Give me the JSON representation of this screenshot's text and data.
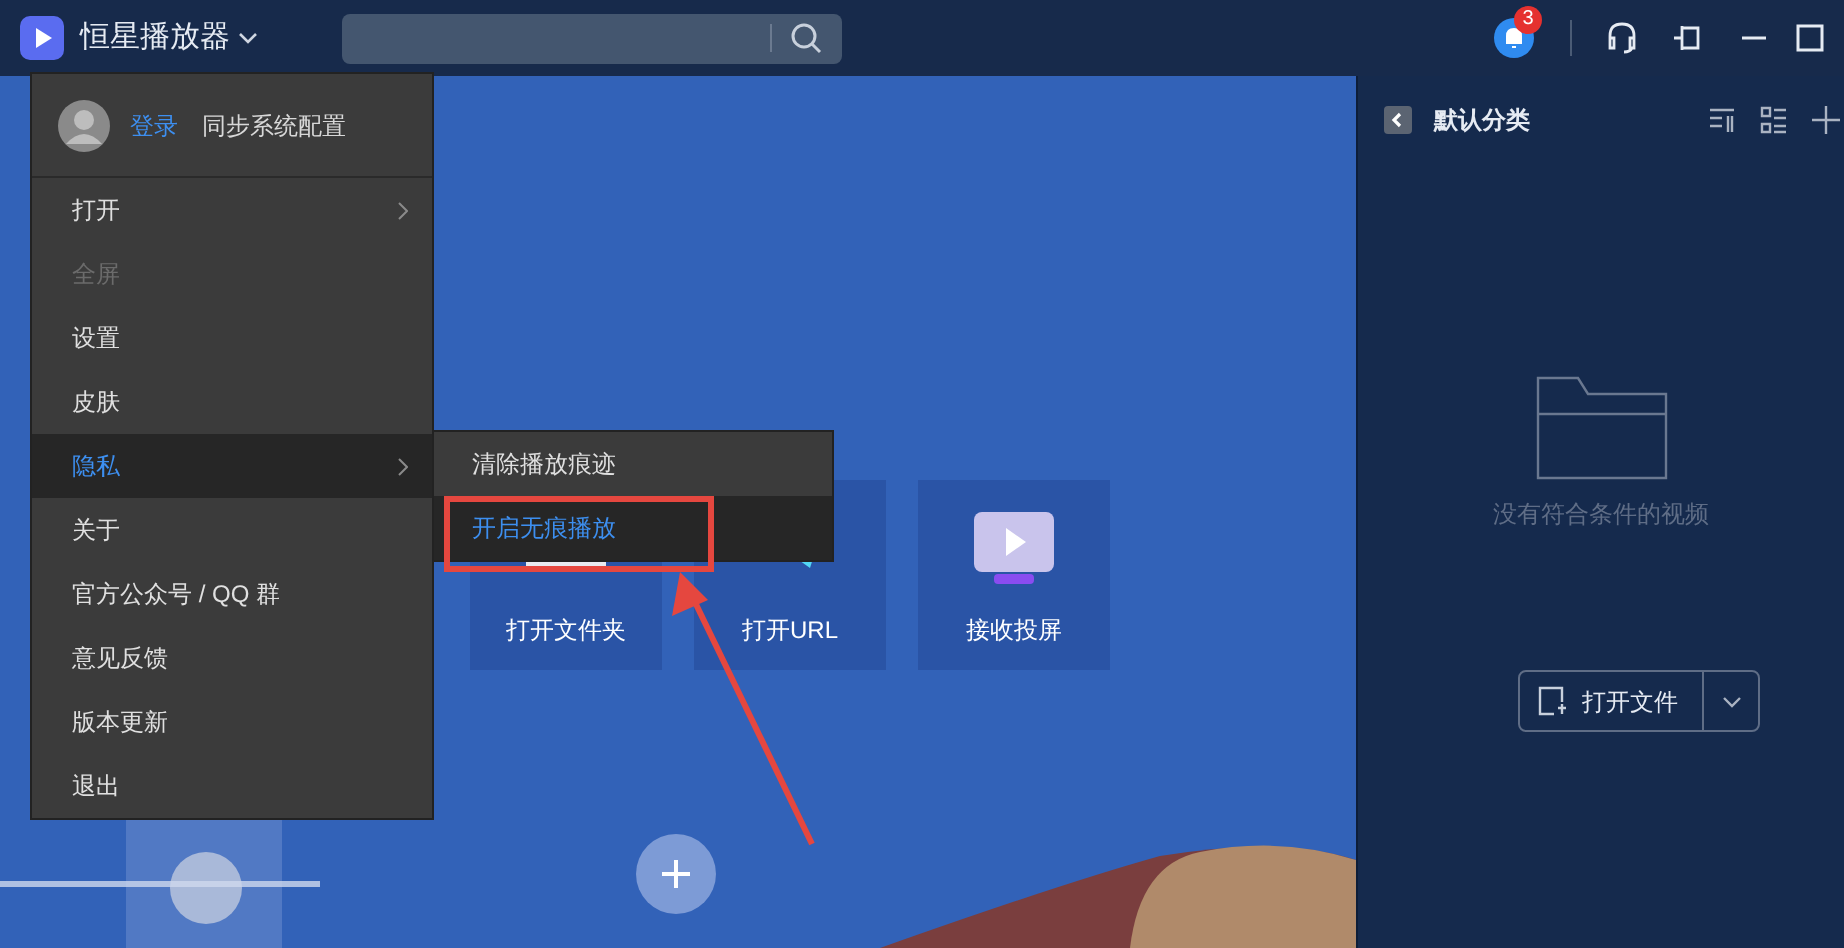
{
  "app": {
    "title": "恒星播放器",
    "notification_count": "3"
  },
  "menu": {
    "login": "登录",
    "sync": "同步系统配置",
    "items": [
      {
        "label": "打开",
        "submenu": true,
        "disabled": false,
        "selected": false
      },
      {
        "label": "全屏",
        "submenu": false,
        "disabled": true,
        "selected": false
      },
      {
        "label": "设置",
        "submenu": false,
        "disabled": false,
        "selected": false
      },
      {
        "label": "皮肤",
        "submenu": false,
        "disabled": false,
        "selected": false
      },
      {
        "label": "隐私",
        "submenu": true,
        "disabled": false,
        "selected": true
      },
      {
        "label": "关于",
        "submenu": false,
        "disabled": false,
        "selected": false
      },
      {
        "label": "官方公众号 / QQ 群",
        "submenu": false,
        "disabled": false,
        "selected": false
      },
      {
        "label": "意见反馈",
        "submenu": false,
        "disabled": false,
        "selected": false
      },
      {
        "label": "版本更新",
        "submenu": false,
        "disabled": false,
        "selected": false
      },
      {
        "label": "退出",
        "submenu": false,
        "disabled": false,
        "selected": false
      }
    ]
  },
  "submenu": {
    "items": [
      {
        "label": "清除播放痕迹",
        "selected": false
      },
      {
        "label": "开启无痕播放",
        "selected": true
      }
    ]
  },
  "tiles": [
    {
      "label": "打开文件夹",
      "kind": "folder"
    },
    {
      "label": "打开URL",
      "kind": "url"
    },
    {
      "label": "接收投屏",
      "kind": "cast"
    }
  ],
  "panel": {
    "title": "默认分类",
    "empty_text": "没有符合条件的视频",
    "open_button": "打开文件"
  }
}
